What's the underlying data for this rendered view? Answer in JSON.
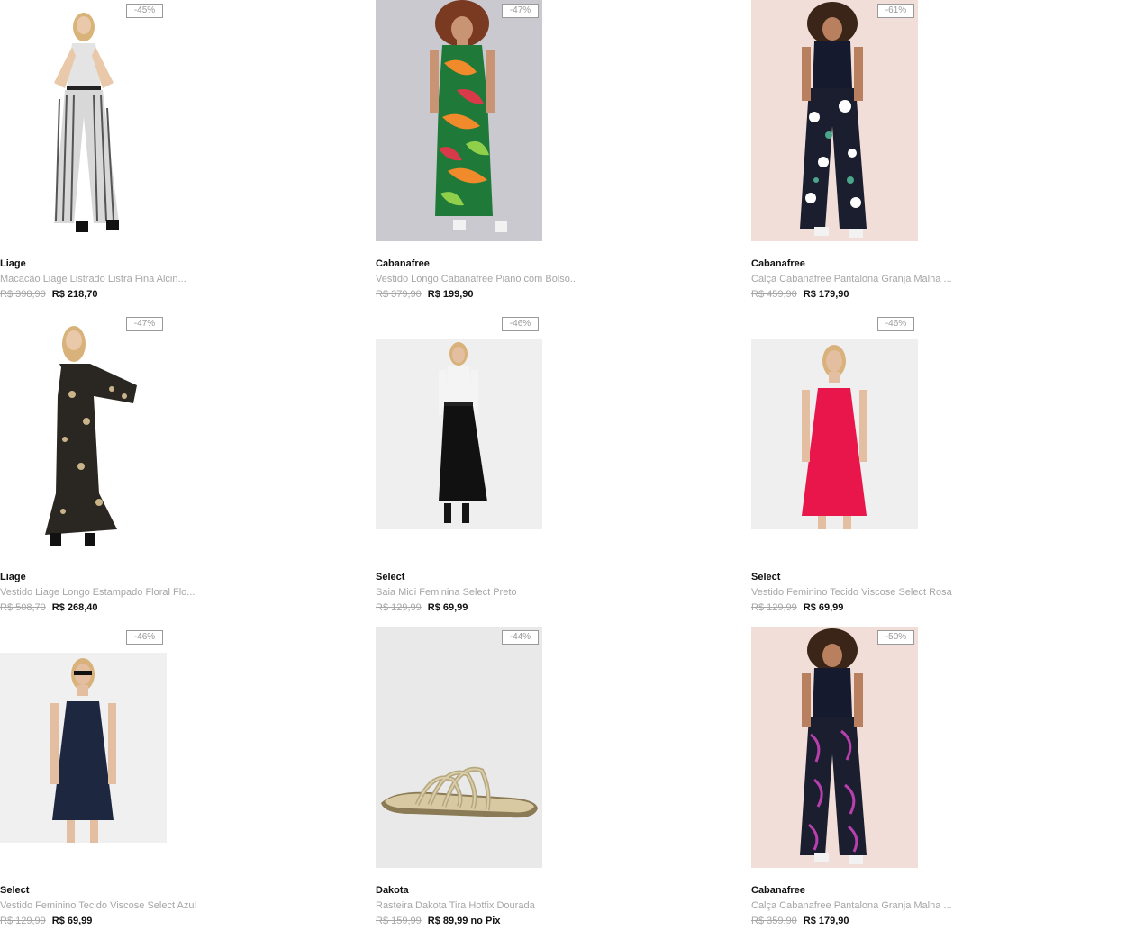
{
  "products": [
    {
      "discount": "-45%",
      "brand": "Liage",
      "name": "Macacão Liage Listrado Listra Fina Alcin...",
      "old_price": "R$ 398,90",
      "price": "R$ 218,70",
      "image": "woman-striped-jumpsuit-photo"
    },
    {
      "discount": "-47%",
      "brand": "Cabanafree",
      "name": "Vestido Longo Cabanafree Piano com Bolso...",
      "old_price": "R$ 379,90",
      "price": "R$ 199,90",
      "image": "woman-tropical-print-dress-photo"
    },
    {
      "discount": "-61%",
      "brand": "Cabanafree",
      "name": "Calça Cabanafree Pantalona Granja Malha ...",
      "old_price": "R$ 459,90",
      "price": "R$ 179,90",
      "image": "woman-floral-wide-pants-photo"
    },
    {
      "discount": "-47%",
      "brand": "Liage",
      "name": "Vestido Liage Longo Estampado Floral Flo...",
      "old_price": "R$ 508,70",
      "price": "R$ 268,40",
      "image": "woman-black-floral-long-dress-photo"
    },
    {
      "discount": "-46%",
      "brand": "Select",
      "name": "Saia Midi Feminina Select Preto",
      "old_price": "R$ 129,99",
      "price": "R$ 69,99",
      "image": "woman-black-midi-skirt-photo"
    },
    {
      "discount": "-46%",
      "brand": "Select",
      "name": "Vestido Feminino Tecido Viscose Select Rosa",
      "old_price": "R$ 129,99",
      "price": "R$ 69,99",
      "image": "woman-pink-dress-photo"
    },
    {
      "discount": "-46%",
      "brand": "Select",
      "name": "Vestido Feminino Tecido Viscose Select Azul",
      "old_price": "R$ 129,99",
      "price": "R$ 69,99",
      "image": "woman-navy-dress-photo"
    },
    {
      "discount": "-44%",
      "brand": "Dakota",
      "name": "Rasteira Dakota Tira Hotfix Dourada",
      "old_price": "R$ 159,99",
      "price": "R$ 89,99 no Pix",
      "image": "gold-sandal-photo"
    },
    {
      "discount": "-50%",
      "brand": "Cabanafree",
      "name": "Calça Cabanafree Pantalona Granja Malha ...",
      "old_price": "R$ 359,90",
      "price": "R$ 179,90",
      "image": "woman-leaf-print-pants-photo"
    }
  ],
  "colors": {
    "muted_text": "#a6a6a6",
    "primary_text": "#111111",
    "badge_border": "#9a9a9a"
  }
}
